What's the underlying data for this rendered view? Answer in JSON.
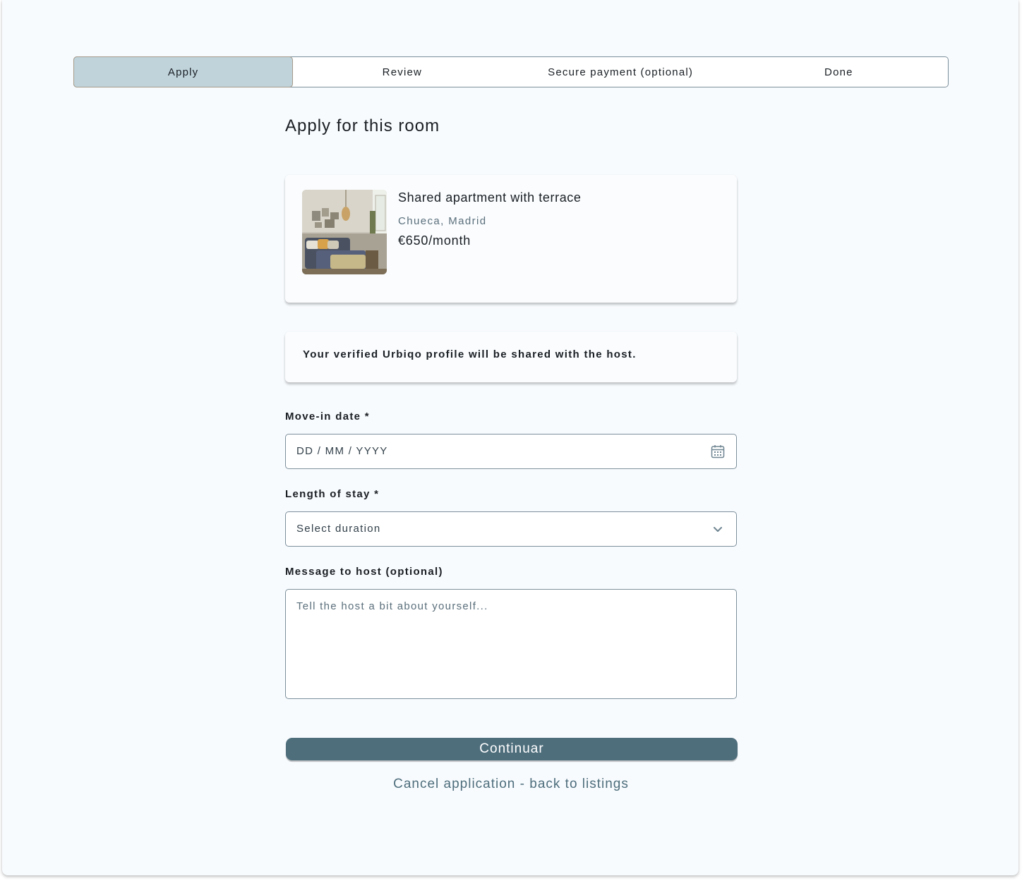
{
  "stepper": {
    "steps": [
      {
        "label": "Apply",
        "active": true
      },
      {
        "label": "Review",
        "active": false
      },
      {
        "label": "Secure payment (optional)",
        "active": false
      },
      {
        "label": "Done",
        "active": false
      }
    ]
  },
  "page": {
    "title": "Apply for this room"
  },
  "listing": {
    "title": "Shared apartment with terrace",
    "location": "Chueca, Madrid",
    "price": "€650/month"
  },
  "profile_notice": "Your verified Urbiqo profile will be shared with the host.",
  "form": {
    "move_in": {
      "label": "Move-in date *",
      "placeholder": "DD / MM / YYYY",
      "icon": "calendar-icon"
    },
    "length": {
      "label": "Length of stay *",
      "value": "Select duration",
      "icon": "chevron-down-icon"
    },
    "message": {
      "label": "Message to host (optional)",
      "placeholder": "Tell the host a bit about yourself..."
    }
  },
  "actions": {
    "continue_label": "Continuar",
    "cancel_label": "Cancel application - back to listings"
  },
  "colors": {
    "accent": "#4e6e7c",
    "active_step": "#c0d3db",
    "border": "#7c8f9b",
    "background": "#f8fbfe"
  }
}
